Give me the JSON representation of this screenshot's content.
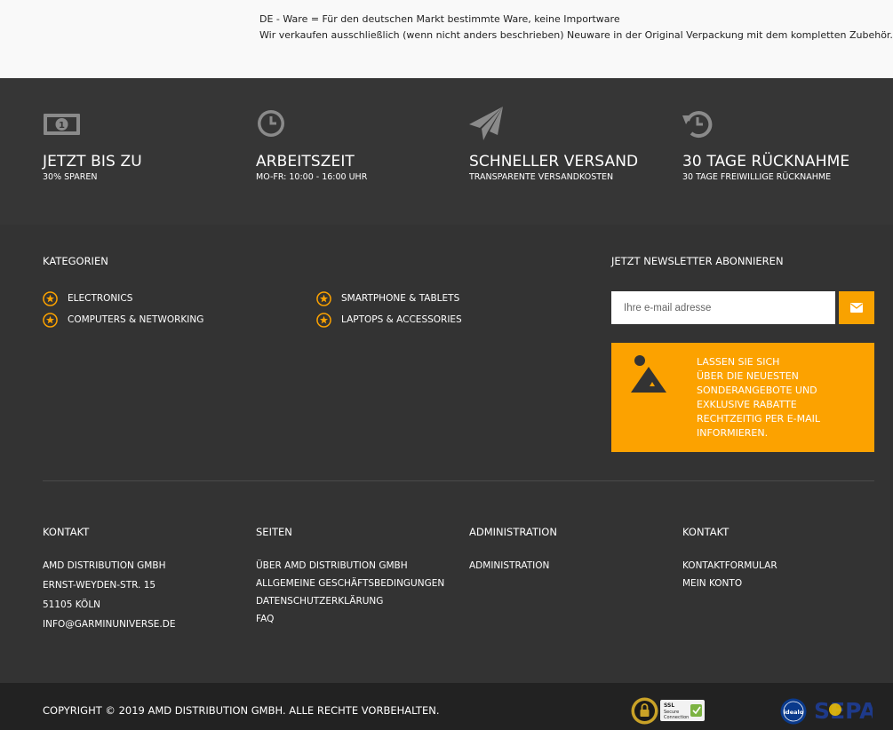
{
  "notice": {
    "line1": "DE - Ware = Für den deutschen Markt bestimmte Ware, keine Importware",
    "line2": "Wir verkaufen ausschließlich (wenn nicht anders beschrieben) Neuware in der Original Verpackung mit dem kompletten Zubehör."
  },
  "features": [
    {
      "icon": "money-icon",
      "title": "JETZT BIS ZU",
      "subtitle": "30% SPAREN"
    },
    {
      "icon": "clock-icon",
      "title": "ARBEITSZEIT",
      "subtitle": "MO-FR: 10:00 - 16:00 UHR"
    },
    {
      "icon": "paper-plane-icon",
      "title": "SCHNELLER VERSAND",
      "subtitle": "TRANSPARENTE VERSANDKOSTEN"
    },
    {
      "icon": "history-icon",
      "title": "30 TAGE RÜCKNAHME",
      "subtitle": "30 TAGE FREIWILLIGE RÜCKNAHME"
    }
  ],
  "categories": {
    "heading": "KATEGORIEN",
    "items": [
      "ELECTRONICS",
      "SMARTPHONE & TABLETS",
      "COMPUTERS & NETWORKING",
      "LAPTOPS & ACCESSORIES"
    ]
  },
  "newsletter": {
    "heading": "JETZT NEWSLETTER ABONNIEREN",
    "placeholder": "Ihre e-mail adresse",
    "button_icon": "envelope-icon",
    "promo_title": "LASSEN SIE SICH",
    "promo_text": "ÜBER DIE NEUESTEN SONDERANGEBOTE UND EXKLUSIVE RABATTE RECHTZEITIG PER E-MAIL INFORMIEREN."
  },
  "contact": {
    "heading": "KONTAKT",
    "lines": [
      "AMD DISTRIBUTION GMBH",
      "ERNST-WEYDEN-STR. 15",
      "51105 KÖLN",
      "INFO@GARMINUNIVERSE.DE"
    ]
  },
  "pages": {
    "heading": "SEITEN",
    "links": [
      "ÜBER AMD DISTRIBUTION GMBH",
      "ALLGEMEINE GESCHÄFTSBEDINGUNGEN",
      "DATENSCHUTZERKLÄRUNG",
      "FAQ"
    ]
  },
  "administration": {
    "heading": "ADMINISTRATION",
    "links": [
      "ADMINISTRATION"
    ]
  },
  "contact2": {
    "heading": "KONTAKT",
    "links": [
      "KONTAKTFORMULAR",
      "MEIN KONTO"
    ]
  },
  "bottom": {
    "copyright": "COPYRIGHT © 2019 AMD DISTRIBUTION GMBH. ALLE RECHTE VORBEHALTEN.",
    "badges": [
      "padlock-seal-icon",
      "ssl-secure-connection-badge",
      "idealo-badge",
      "sepa-logo"
    ],
    "ssl_lines": [
      "SSL",
      "Secure",
      "Connection"
    ],
    "idealo_text": "idealo",
    "sepa_text": "SEPA"
  },
  "colors": {
    "accent": "#fca200",
    "dark": "#333333",
    "darker": "#222222",
    "icon_gray": "#8a8a8a"
  }
}
